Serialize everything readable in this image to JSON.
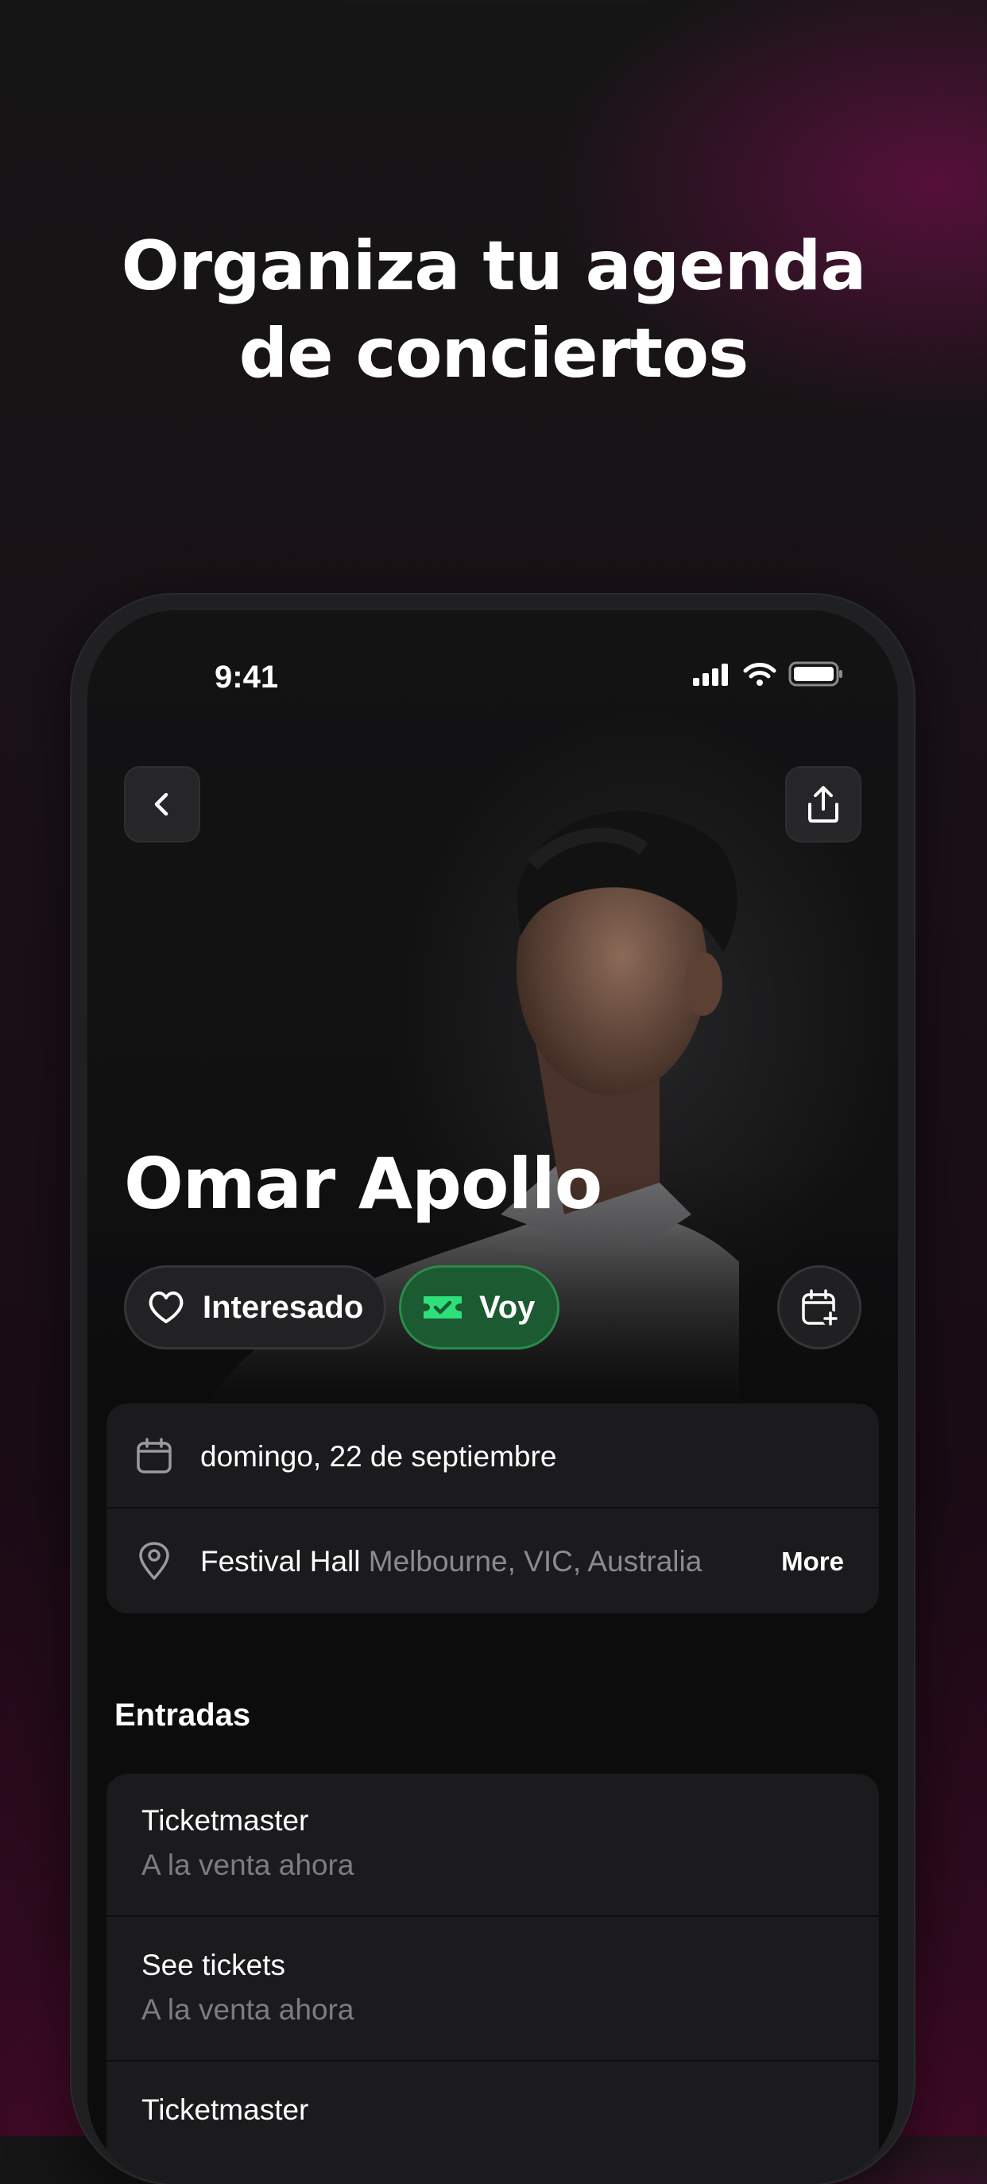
{
  "headline": {
    "line1": "Organiza tu agenda",
    "line2": "de conciertos"
  },
  "status_bar": {
    "time": "9:41",
    "icons": [
      "cellular-signal-icon",
      "wifi-icon",
      "battery-icon"
    ]
  },
  "header": {
    "back_icon": "chevron-left-icon",
    "share_icon": "share-icon"
  },
  "event": {
    "artist": "Omar Apollo",
    "actions": {
      "interested_label": "Interesado",
      "going_label": "Voy",
      "calendar_icon": "calendar-add-icon"
    },
    "date": "domingo, 22 de septiembre",
    "venue": "Festival Hall",
    "venue_location": "Melbourne, VIC, Australia",
    "more_label": "More"
  },
  "tickets": {
    "section_title": "Entradas",
    "items": [
      {
        "name": "Ticketmaster",
        "status": "A la venta ahora"
      },
      {
        "name": "See tickets",
        "status": "A la venta ahora"
      },
      {
        "name": "Ticketmaster",
        "status": ""
      }
    ]
  },
  "colors": {
    "background": "#151515",
    "accent_magenta": "#7d0e46",
    "going_green": "#1c5a32",
    "going_icon_green": "#2fe07a",
    "card": "#1b1b1d",
    "muted_text": "#8b8b8e"
  }
}
